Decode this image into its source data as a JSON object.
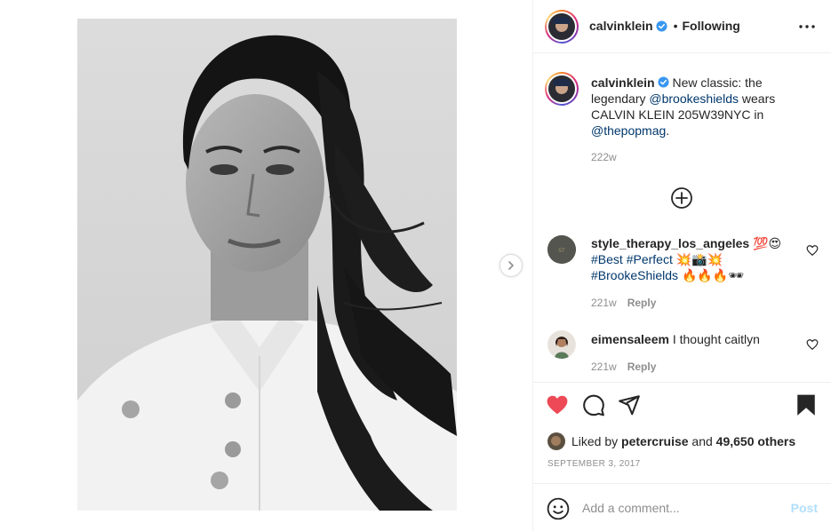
{
  "post": {
    "author": "calvinklein",
    "follow_sep": "•",
    "follow_label": "Following",
    "more_icon": "more-horizontal-icon"
  },
  "caption": {
    "username": "calvinklein",
    "text_before": "New classic: the legendary ",
    "mention_1": "@brookeshields",
    "text_middle": " wears CALVIN KLEIN 205W39NYC in ",
    "mention_2": "@thepopmag",
    "text_end": ".",
    "time": "222w"
  },
  "comments": [
    {
      "username": "style_therapy_los_angeles",
      "emoji_inline": "💯😍",
      "tags": [
        "#Best",
        "#Perfect"
      ],
      "emoji_after_tags": "💥📸💥",
      "tag3": "#BrookeShields",
      "emoji_end": "🔥🔥🔥🕶",
      "time": "221w",
      "reply_label": "Reply"
    },
    {
      "username": "eimensaleem",
      "text": "I thought caitlyn",
      "time": "221w",
      "reply_label": "Reply"
    }
  ],
  "likes": {
    "prefix": "Liked by",
    "liker": "petercruise",
    "and": "and",
    "others": "49,650 others"
  },
  "date": "SEPTEMBER 3, 2017",
  "add_comment": {
    "placeholder": "Add a comment...",
    "post_label": "Post"
  },
  "colors": {
    "like_red": "#ed4956",
    "link_blue": "#00376b",
    "post_disabled": "#b2dffc",
    "verified_blue": "#3897f0"
  }
}
